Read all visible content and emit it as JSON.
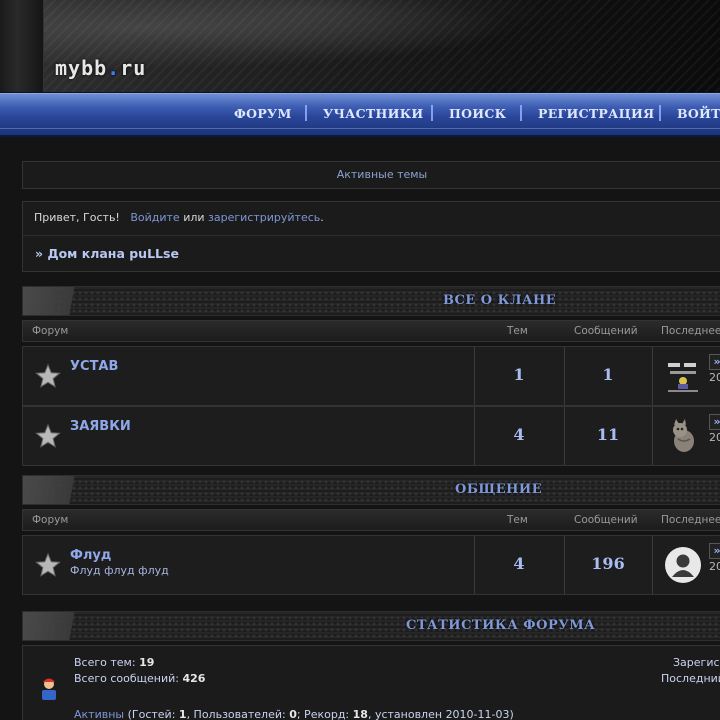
{
  "header": {
    "logo_main": "mybb",
    "logo_dot": ".",
    "logo_tail": "ru"
  },
  "nav": {
    "items": [
      {
        "label": "ФОРУМ"
      },
      {
        "label": "УЧАСТНИКИ"
      },
      {
        "label": "ПОИСК"
      },
      {
        "label": "РЕГИСТРАЦИЯ"
      },
      {
        "label": "ВОЙТИ"
      }
    ],
    "separator": "||"
  },
  "active_topics": {
    "label": "Активные темы"
  },
  "greeting": {
    "hello": "Привет, Гость!",
    "login": "Войдите",
    "or": "или",
    "register": "зарегистрируйтесь",
    "period": "."
  },
  "breadcrumb": {
    "arrow": "»",
    "title": "Дом клана puLLse"
  },
  "table_headers": {
    "forum": "Форум",
    "topics": "Тем",
    "posts": "Сообщений",
    "last": "Последнее"
  },
  "categories": [
    {
      "title": "ВСЕ О КЛАНЕ",
      "forums": [
        {
          "title": "УСТАВ",
          "desc": "",
          "topics": "1",
          "posts": "1",
          "avatar": "sign-avatar",
          "last_date": "20"
        },
        {
          "title": "ЗАЯВКИ",
          "desc": "",
          "topics": "4",
          "posts": "11",
          "avatar": "cat-avatar",
          "last_date": "20"
        }
      ]
    },
    {
      "title": "ОБЩЕНИЕ",
      "forums": [
        {
          "title": "Флуд",
          "desc": "Флуд флуд флуд",
          "topics": "4",
          "posts": "196",
          "avatar": "default-user-avatar",
          "last_date": "20"
        }
      ]
    }
  ],
  "last_arrow": "»",
  "stats": {
    "title": "СТАТИСТИКА ФОРУМА",
    "total_topics_label": "Всего тем:",
    "total_topics": "19",
    "total_posts_label": "Всего сообщений:",
    "total_posts": "426",
    "registered_label": "Зарегис",
    "last_label": "Последний",
    "active_link": "Активны",
    "active_open": "(Гостей:",
    "guests": "1",
    "users_label": ", Пользователей:",
    "users": "0",
    "record_label": "; Рекорд:",
    "record": "18",
    "record_date_label": ", установлен",
    "record_date": "2010-11-03",
    "active_close": ")"
  },
  "colors": {
    "nav_blue": "#2a469a",
    "accent_link": "#7d96d6",
    "title_blue": "#8ea8ea"
  }
}
